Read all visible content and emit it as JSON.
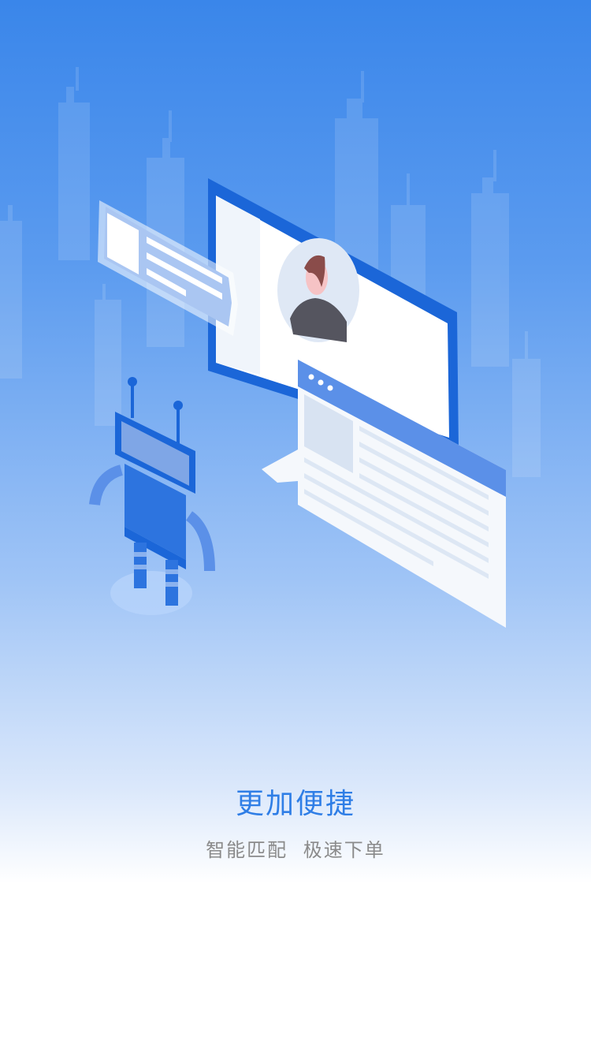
{
  "onboarding": {
    "title": "更加便捷",
    "subtitle": "智能匹配  极速下单"
  },
  "colors": {
    "accent": "#2f7ee6",
    "subtitle_gray": "#8a8a8a",
    "monitor_blue": "#1b66d8"
  }
}
